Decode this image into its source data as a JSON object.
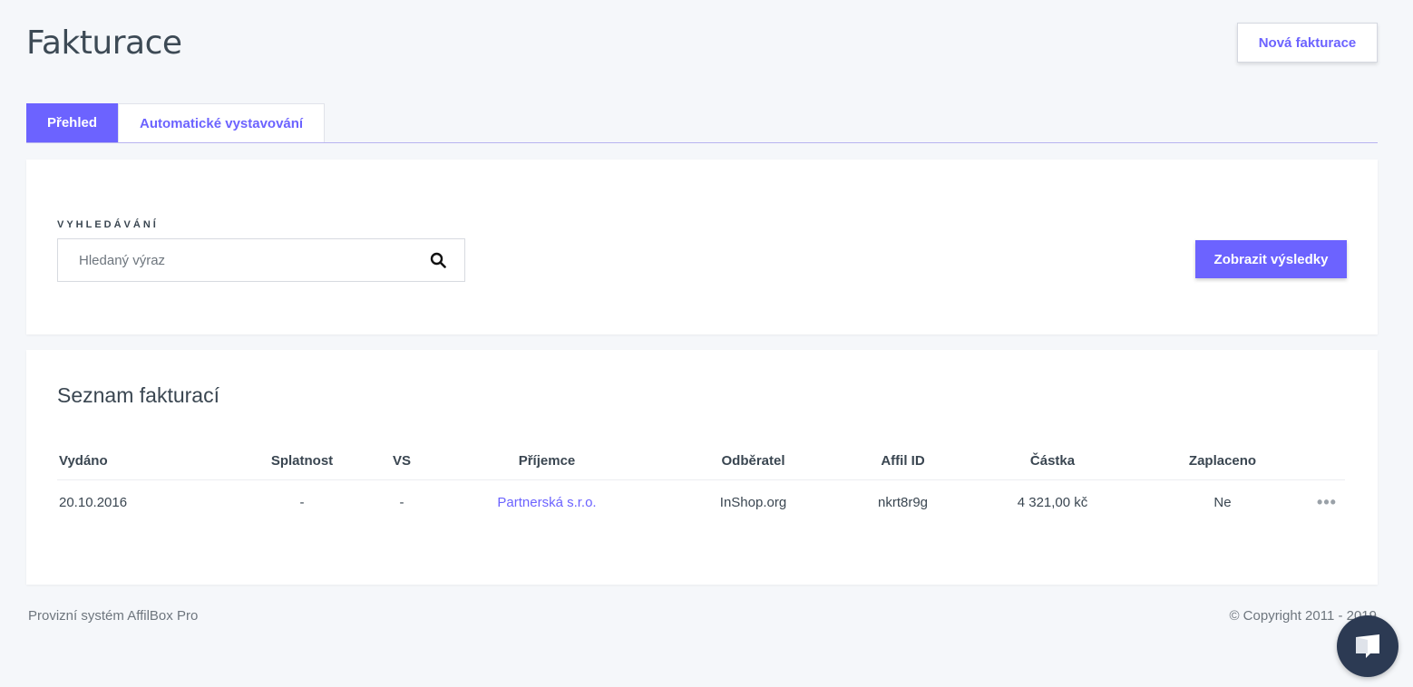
{
  "header": {
    "title": "Fakturace",
    "new_invoice_label": "Nová fakturace"
  },
  "tabs": [
    {
      "label": "Přehled",
      "active": true
    },
    {
      "label": "Automatické vystavování",
      "active": false
    }
  ],
  "search": {
    "label": "VYHLEDÁVÁNÍ",
    "placeholder": "Hledaný výraz",
    "value": "",
    "submit_label": "Zobrazit výsledky"
  },
  "list": {
    "title": "Seznam fakturací",
    "columns": [
      "Vydáno",
      "Splatnost",
      "VS",
      "Příjemce",
      "Odběratel",
      "Affil ID",
      "Částka",
      "Zaplaceno"
    ],
    "rows": [
      {
        "issued": "20.10.2016",
        "due": "-",
        "vs": "-",
        "recipient": "Partnerská s.r.o.",
        "customer": "InShop.org",
        "affil_id": "nkrt8r9g",
        "amount": "4 321,00 kč",
        "paid": "Ne",
        "actions": "•••"
      }
    ]
  },
  "footer": {
    "left": "Provizní systém AffilBox Pro",
    "right": "© Copyright 2011 - 2019"
  },
  "colors": {
    "accent": "#6c63ff",
    "chat": "#2c3a53",
    "background": "#f5f7fa"
  },
  "icons": {
    "search": "search-icon",
    "chat": "chat-icon"
  }
}
